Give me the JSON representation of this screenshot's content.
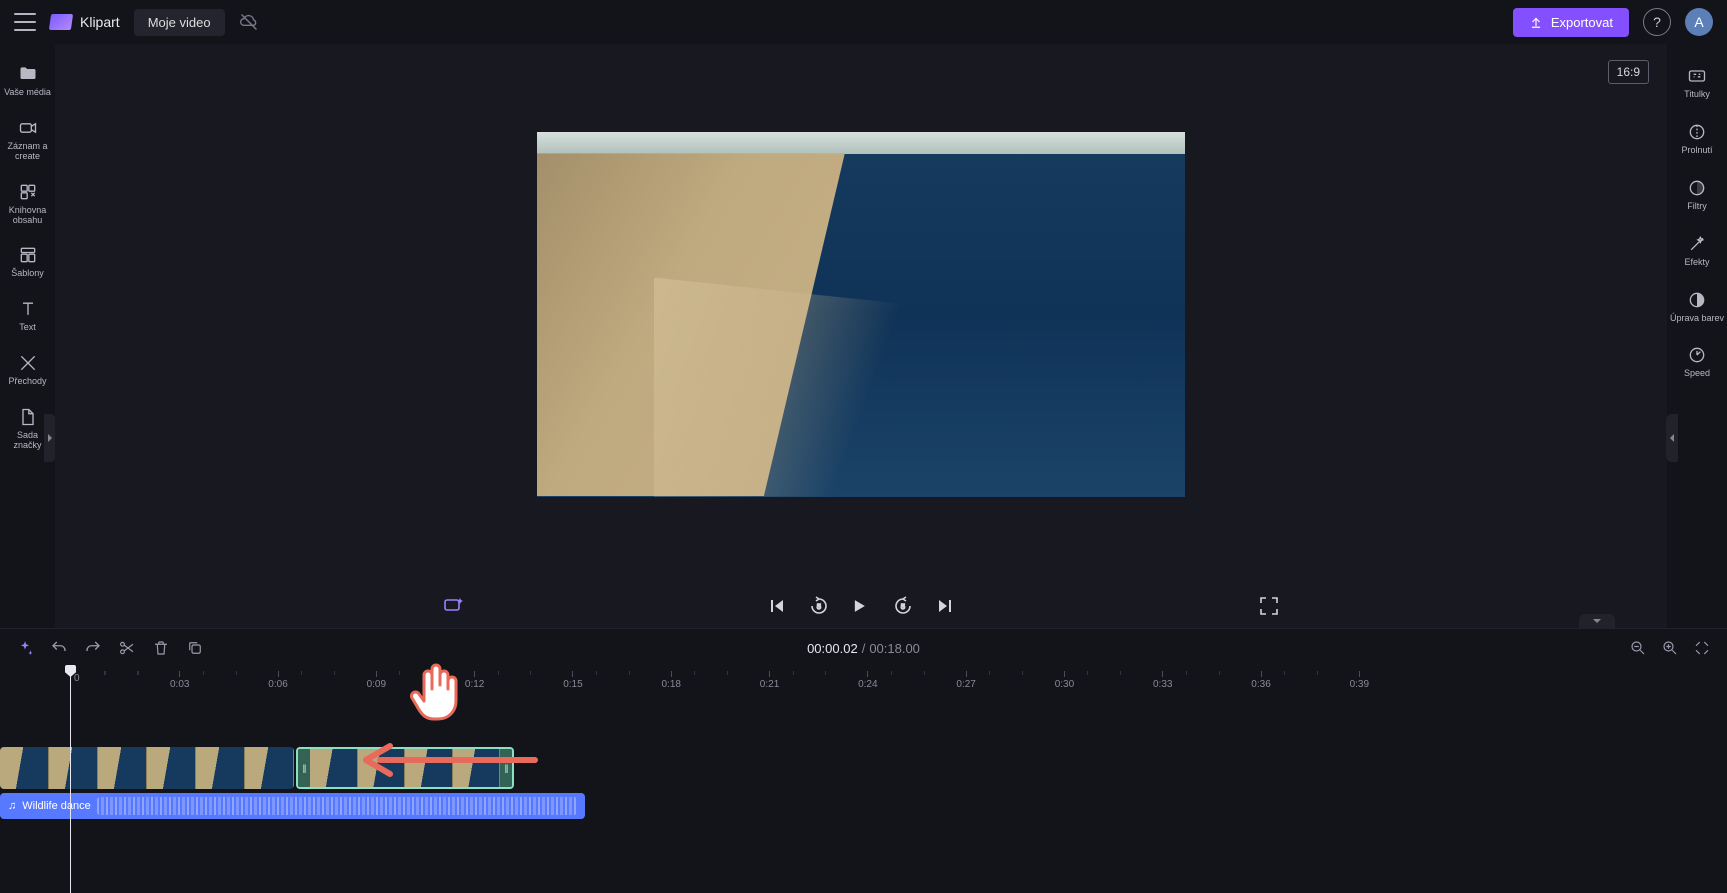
{
  "header": {
    "brand": "Klipart",
    "project_btn": "Moje video",
    "export_btn": "Exportovat",
    "avatar_initial": "A",
    "aspect_ratio": "16:9"
  },
  "left_sidebar": {
    "items": [
      {
        "id": "media",
        "label": "Vaše média"
      },
      {
        "id": "record",
        "label": "Záznam a create"
      },
      {
        "id": "library",
        "label": "Knihovna obsahu"
      },
      {
        "id": "templates",
        "label": "Šablony"
      },
      {
        "id": "text",
        "label": "Text"
      },
      {
        "id": "transitions",
        "label": "Přechody"
      },
      {
        "id": "brand",
        "label": "Sada značky"
      }
    ]
  },
  "right_sidebar": {
    "items": [
      {
        "id": "captions",
        "label": "Titulky"
      },
      {
        "id": "fade",
        "label": "Prolnutí"
      },
      {
        "id": "filters",
        "label": "Filtry"
      },
      {
        "id": "effects",
        "label": "Efekty"
      },
      {
        "id": "color",
        "label": "Úprava barev"
      },
      {
        "id": "speed",
        "label": "Speed"
      }
    ]
  },
  "timeline": {
    "current_time": "00:00.02",
    "total_time": "00:18.00",
    "time_separator": "/",
    "ruler_start": "0",
    "ruler_marks": [
      "0:03",
      "0:06",
      "0:09",
      "0:12",
      "0:15",
      "0:18",
      "0:21",
      "0:24",
      "0:27",
      "0:30",
      "0:33",
      "0:36",
      "0:39"
    ],
    "audio_clip_name": "Wildlife dance"
  }
}
